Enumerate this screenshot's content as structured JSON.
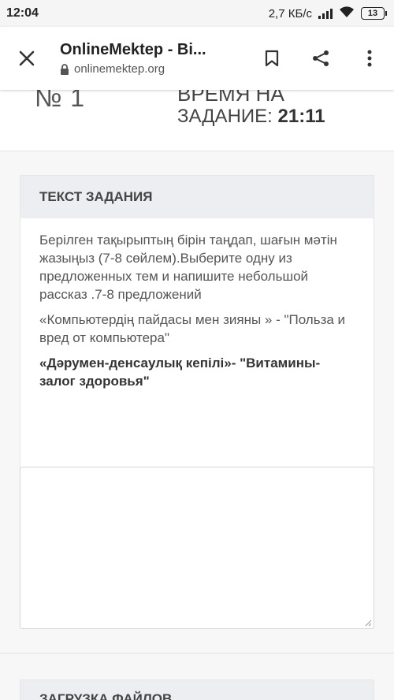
{
  "status": {
    "time": "12:04",
    "speed": "2,7 КБ/с",
    "battery": "13"
  },
  "toolbar": {
    "title": "OnlineMektep - Bi...",
    "url": "onlinemektep.org"
  },
  "task": {
    "number": "№ 1",
    "time_label_1": "ВРЕМЯ НА",
    "time_label_2": "ЗАДАНИЕ:",
    "time_value": "21:11"
  },
  "card": {
    "header": "ТЕКСТ ЗАДАНИЯ",
    "paragraph1": "Берілген тақырыптың бірін таңдап, шағын мәтін жазыңыз (7-8 сөйлем).Выберите одну из предложенных тем и напишите небольшой рассказ .7-8 предложений",
    "paragraph2": "«Компьютердің пайдасы мен зияны » - \"Польза и вред от компьютера\"",
    "paragraph3": "«Дәрумен-денсаулық кепілі»- \"Витамины-залог здоровья\""
  },
  "answer": {
    "value": ""
  },
  "upload": {
    "title": "ЗАГРУЗКА ФАЙЛОВ"
  }
}
